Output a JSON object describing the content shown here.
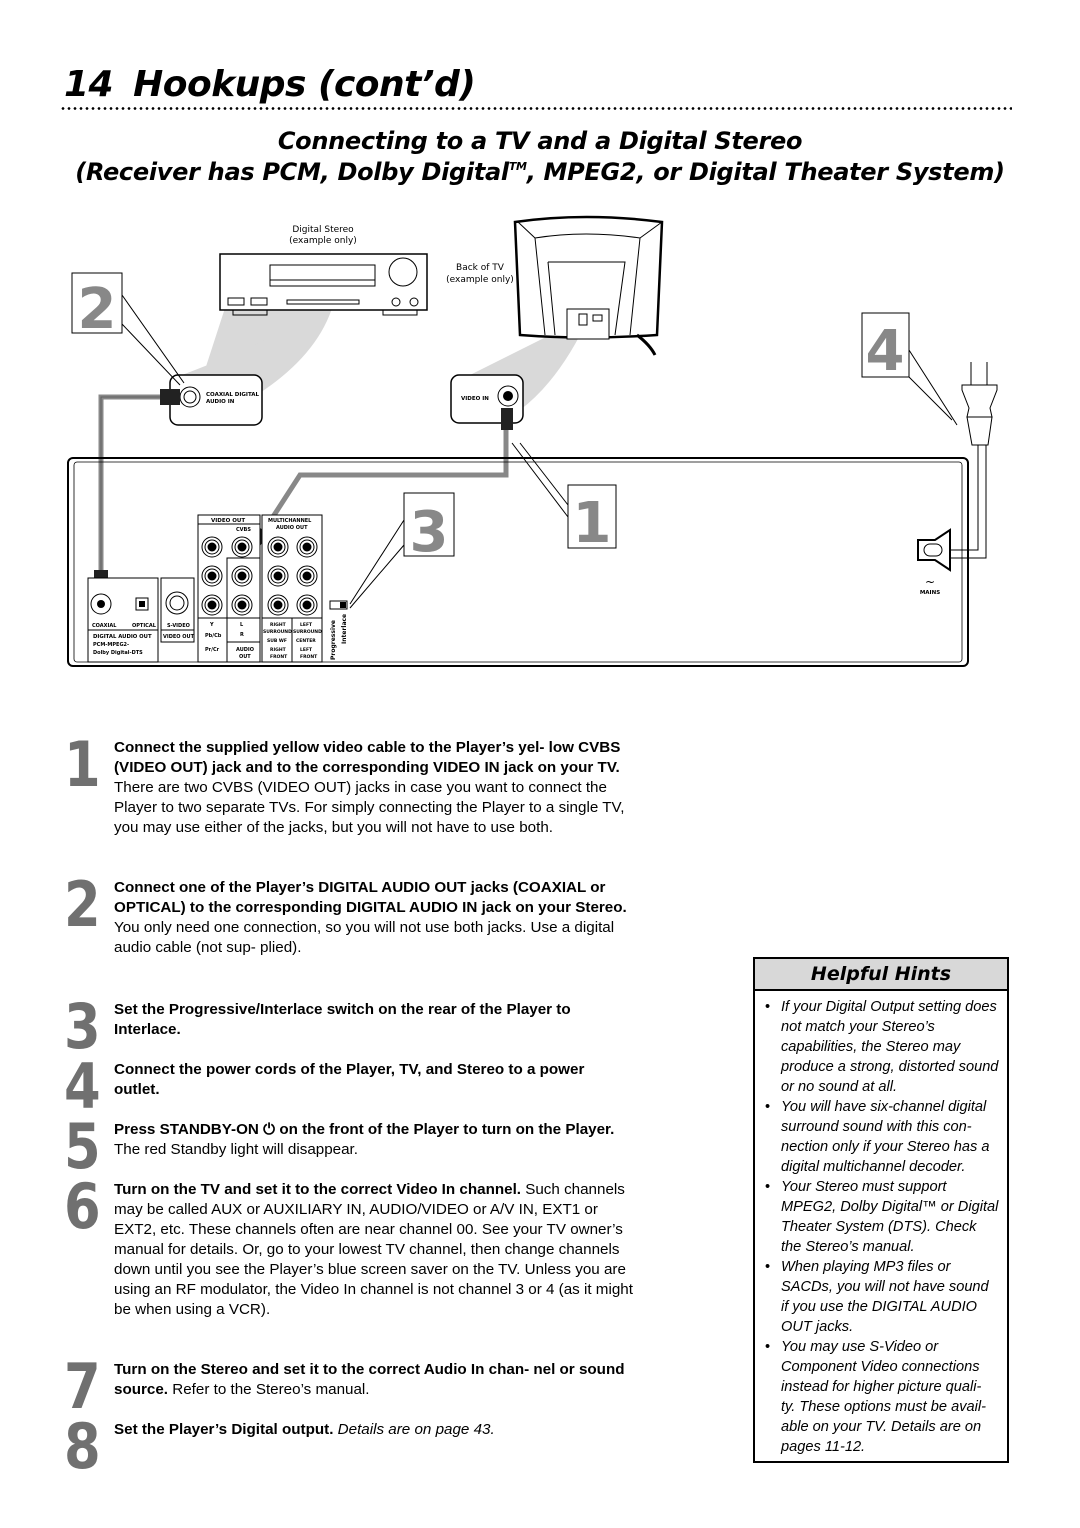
{
  "header": {
    "page_number": "14",
    "title": "Hookups (cont’d)"
  },
  "section": {
    "title": "Connecting to a TV and a Digital Stereo",
    "subtitle_pre": "(Receiver has PCM, Dolby Digital",
    "subtitle_tm": "TM",
    "subtitle_post": ", MPEG2, or Digital Theater System)"
  },
  "diagram": {
    "stereo_label_1": "Digital Stereo",
    "stereo_label_2": "(example only)",
    "tv_label_1": "Back of TV",
    "tv_label_2": "(example only)",
    "coaxial_in_label_1": "COAXIAL DIGITAL",
    "coaxial_in_label_2": "AUDIO IN",
    "video_in_label": "VIDEO IN",
    "callouts": [
      "2",
      "4",
      "3",
      "1"
    ],
    "player": {
      "video_out": "VIDEO OUT",
      "cvbs": "CVBS",
      "multichannel_1": "MULTICHANNEL",
      "multichannel_2": "AUDIO OUT",
      "coaxial": "COAXIAL",
      "optical": "OPTICAL",
      "svideo": "S-VIDEO",
      "svideo_out": "VIDEO OUT",
      "digital_audio_out_1": "DIGITAL AUDIO OUT",
      "digital_audio_out_2": "PCM-MPEG2-",
      "digital_audio_out_3": "Dolby Digital-DTS",
      "y": "Y",
      "pb": "Pb/Cb",
      "pr": "Pr/Cr",
      "l": "L",
      "r": "R",
      "audio_out_1": "AUDIO",
      "audio_out_2": "OUT",
      "right_surround_1": "RIGHT",
      "right_surround_2": "SURROUND",
      "left_surround_1": "LEFT",
      "left_surround_2": "SURROUND",
      "sub_wf": "SUB WF",
      "center": "CENTER",
      "right_front_1": "RIGHT",
      "right_front_2": "FRONT",
      "left_front_1": "LEFT",
      "left_front_2": "FRONT",
      "progressive": "Progressive",
      "interlace": "Interlace",
      "mains_symbol": "~",
      "mains": "MAINS"
    }
  },
  "steps": [
    {
      "num": "1",
      "bold": "Connect the supplied yellow video cable to the Player’s yel- low CVBS (VIDEO OUT) jack and to the corresponding VIDEO IN jack on your TV.",
      "text": " There are two CVBS (VIDEO OUT) jacks in case you want to connect the Player to two separate TVs. For simply connecting the Player to a single TV, you may use either of the jacks, but you will not have to use both.",
      "italic": ""
    },
    {
      "num": "2",
      "bold": "Connect one of the Player’s DIGITAL AUDIO OUT jacks (COAXIAL or OPTICAL) to the corresponding DIGITAL AUDIO IN jack on your Stereo.",
      "text": " You only need one connection, so you will not use both jacks. Use a digital audio cable (not sup- plied).",
      "italic": ""
    },
    {
      "num": "3",
      "bold": "Set the Progressive/Interlace switch on the rear of the Player to Interlace.",
      "text": "",
      "italic": ""
    },
    {
      "num": "4",
      "bold": "Connect the power cords of the Player, TV, and Stereo to a power outlet.",
      "text": "",
      "italic": ""
    },
    {
      "num": "5",
      "bold": "Press STANDBY-ON ⏻ on the front of the Player to turn on the Player.",
      "text": " The red Standby light will disappear.",
      "italic": ""
    },
    {
      "num": "6",
      "bold": "Turn on the TV and set it to the correct Video In channel.",
      "text": " Such channels may be called AUX or AUXILIARY IN, AUDIO/VIDEO or A/V IN, EXT1 or EXT2, etc. These channels often are near channel 00. See your TV owner’s manual for details. Or, go to your lowest TV channel, then change channels down until you see the Player’s blue screen saver on the TV. Unless you are using an RF modulator, the Video In channel is not channel 3 or 4 (as it might be when using a VCR).",
      "italic": ""
    },
    {
      "num": "7",
      "bold": "Turn on the Stereo and set it to the correct Audio In chan- nel or sound source.",
      "text": " Refer to the Stereo’s manual.",
      "italic": ""
    },
    {
      "num": "8",
      "bold": "Set the Player’s Digital output.",
      "text": " ",
      "italic": "Details are on page 43."
    }
  ],
  "hints": {
    "title": "Helpful Hints",
    "bullet": "•",
    "items": [
      "If your Digital Output setting does not match your Stereo’s capabilities, the Stereo may produce a strong, distorted sound or no sound at all.",
      "You will have six-channel digital surround sound with this con- nection only if your Stereo has a digital multichannel decoder.",
      "Your Stereo must support MPEG2, Dolby Digital™ or Digital Theater System (DTS). Check the Stereo’s manual.",
      "When playing MP3 files or SACDs, you will not have sound if you use the DIGITAL AUDIO OUT jacks.",
      "You may use S-Video or Component Video connections instead for higher picture quali- ty. These options must be avail- able on your TV. Details are on pages 11-12."
    ]
  }
}
